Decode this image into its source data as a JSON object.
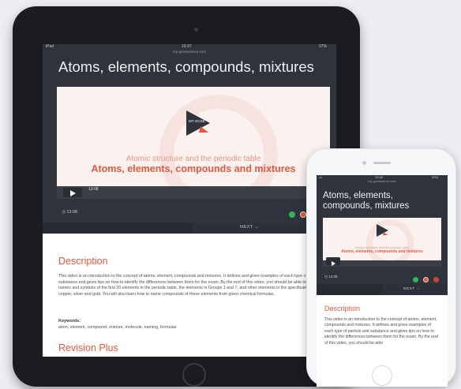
{
  "tablet": {
    "status": {
      "carrier": "iPad",
      "time": "10:37",
      "battery": "97%"
    },
    "url": "my-gcsescience.com",
    "page_title": "Atoms, elements, compounds, mixtures",
    "video": {
      "logo_text": "MY GCSE",
      "subtitle": "Atomic structure and the periodic table",
      "title": "Atoms, elements, compounds and mixtures",
      "progress_time": "13:08",
      "duration": "13:08"
    },
    "next_label": "NEXT →",
    "description_heading": "Description",
    "description": "This video is an introduction to the concept of atoms, element, compounds and mixtures. It defines and gives examples of each type of particle and substance and gives tips on how to identify the differences between them for the exam. By the end of this video, you should be able to use the names and symbols of the first 20 elements in the periodic table, the elements in Groups 1 and 7, and other elements in the specification such as copper, silver and gold. You will also learn how to name compounds of these elements from given chemical formulas.",
    "keywords_label": "Keywords:",
    "keywords": "atom, element, compound, mixture, molecule, naming, formulae",
    "revision_heading": "Revision Plus"
  },
  "phone": {
    "status": {
      "carrier": "•••",
      "time": "10:46",
      "battery": "99%"
    },
    "url": "my-gcsescience.com",
    "page_title": "Atoms, elements, compounds, mixtures",
    "video": {
      "subtitle": "Atomic structure and the periodic table",
      "title": "Atoms, elements, compounds and mixtures",
      "progress_time": "13:08",
      "duration": "13:08"
    },
    "next_label": "NEXT →",
    "description_heading": "Description",
    "description": "This video is an introduction to the concept of atoms, element, compounds and mixtures. It defines and gives examples of each type of particle and substance and gives tips on how to identify the differences between them for the exam. By the end of this video, you should be able"
  },
  "colors": {
    "accent": "#e4583f",
    "dark": "#2f343c",
    "green": "#34b558",
    "red": "#e4583f"
  }
}
